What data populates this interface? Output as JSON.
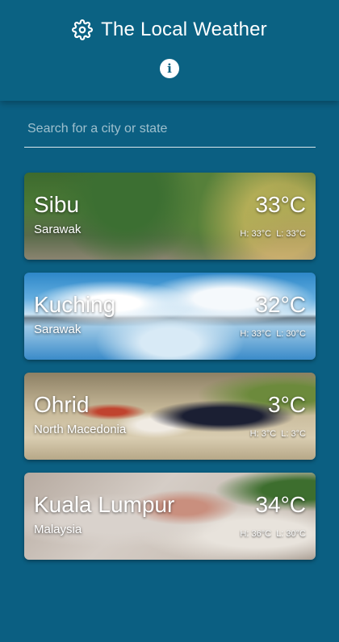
{
  "header": {
    "title": "The Local Weather",
    "settings_icon": "gear-icon",
    "info_icon": "info-icon",
    "info_glyph": "i"
  },
  "search": {
    "placeholder": "Search for a city or state",
    "value": ""
  },
  "cards": [
    {
      "city": "Sibu",
      "region": "Sarawak",
      "temp": "33°C",
      "high": "H: 33°C",
      "low": "L: 33°C"
    },
    {
      "city": "Kuching",
      "region": "Sarawak",
      "temp": "32°C",
      "high": "H: 33°C",
      "low": "L: 30°C"
    },
    {
      "city": "Ohrid",
      "region": "North Macedonia",
      "temp": "3°C",
      "high": "H: 3°C",
      "low": "L: 3°C"
    },
    {
      "city": "Kuala Lumpur",
      "region": "Malaysia",
      "temp": "34°C",
      "high": "H: 36°C",
      "low": "L: 30°C"
    }
  ],
  "colors": {
    "background": "#0b5f82",
    "header": "#0b6283",
    "text": "#ffffff"
  }
}
